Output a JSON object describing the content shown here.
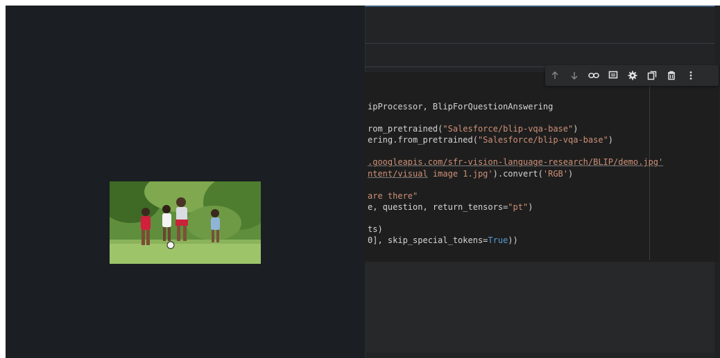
{
  "colors": {
    "background": "#1f2123",
    "code_text": "#d4d4d4",
    "string": "#ce9178",
    "keyword": "#569cd6",
    "toolbar": "#2a2b2d"
  },
  "photo": {
    "subject": "children playing soccer on grass"
  },
  "cell_toolbar": {
    "icons": [
      "arrow-up-icon",
      "arrow-down-icon",
      "link-icon",
      "comment-icon",
      "gear-icon",
      "mirror-cell-icon",
      "trash-icon",
      "more-vert-icon"
    ]
  },
  "code": {
    "lines": [
      {
        "parts": [
          {
            "t": "ipProcessor, BlipForQuestionAnswering",
            "c": ""
          }
        ]
      },
      {
        "parts": []
      },
      {
        "parts": [
          {
            "t": "rom_pretrained(",
            "c": ""
          },
          {
            "t": "\"Salesforce/blip-vqa-base\"",
            "c": "s"
          },
          {
            "t": ")",
            "c": ""
          }
        ]
      },
      {
        "parts": [
          {
            "t": "ering.from_pretrained(",
            "c": ""
          },
          {
            "t": "\"Salesforce/blip-vqa-base\"",
            "c": "s"
          },
          {
            "t": ")",
            "c": ""
          }
        ]
      },
      {
        "parts": []
      },
      {
        "parts": [
          {
            "t": ".googleapis.com/sfr-vision-language-research/BLIP/demo.jpg'",
            "c": "s u"
          }
        ]
      },
      {
        "parts": [
          {
            "t": "ntent/visual",
            "c": "s u"
          },
          {
            "t": " image 1.jpg'",
            "c": "s"
          },
          {
            "t": ").convert(",
            "c": ""
          },
          {
            "t": "'RGB'",
            "c": "s"
          },
          {
            "t": ")",
            "c": ""
          }
        ]
      },
      {
        "parts": []
      },
      {
        "parts": [
          {
            "t": "are there\"",
            "c": "s"
          }
        ]
      },
      {
        "parts": [
          {
            "t": "e, question, return_tensors=",
            "c": ""
          },
          {
            "t": "\"pt\"",
            "c": "s"
          },
          {
            "t": ")",
            "c": ""
          }
        ]
      },
      {
        "parts": []
      },
      {
        "parts": [
          {
            "t": "ts)",
            "c": ""
          }
        ]
      },
      {
        "parts": [
          {
            "t": "0], skip_special_tokens=",
            "c": ""
          },
          {
            "t": "True",
            "c": "k"
          },
          {
            "t": "))",
            "c": ""
          }
        ]
      }
    ]
  }
}
